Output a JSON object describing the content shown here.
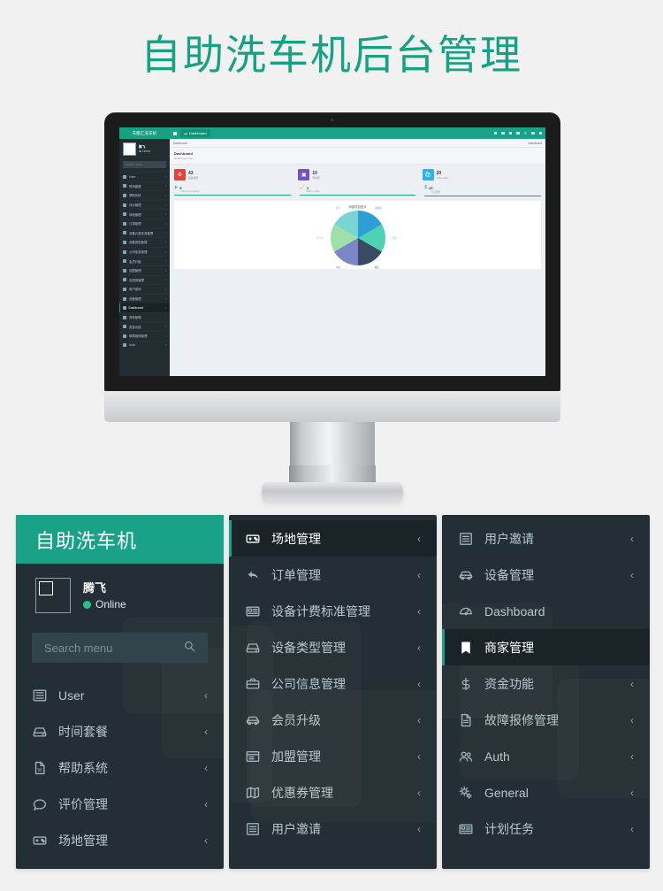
{
  "page": {
    "title": "自助洗车机后台管理",
    "title_color": "#17a184",
    "background": "#f1f1f1"
  },
  "screen": {
    "brand": "车酷汇洗车机",
    "nav_tab": "Dashboard",
    "breadcrumb_left": "Dashboard",
    "breadcrumb_right": "Dashboard",
    "page_header": "Dashboard",
    "page_subtitle": "Dashboard Tips",
    "search_placeholder": "Search menu",
    "user_name": "腾飞",
    "user_status": "Online",
    "stats": [
      {
        "value": "43",
        "label": "设备数量",
        "color": "#e8413d"
      },
      {
        "value": "10",
        "label": "场地数",
        "color": "#6f52c4"
      },
      {
        "value": "20",
        "label": "Total order",
        "color": "#2ab5e6"
      }
    ],
    "mini_stats": [
      {
        "value": "9",
        "label": "Today user signup",
        "color": "#19a287"
      },
      {
        "value": "2",
        "label": "Today's order",
        "color": "#19a287"
      },
      {
        "value": "20",
        "label": "今日营收",
        "color": "#19a287"
      }
    ],
    "chart_title": "消费项目统计",
    "sidebar_items": [
      "User",
      "时间套餐",
      "帮助系统",
      "评价管理",
      "场地管理",
      "订单管理",
      "设备计费标准管理",
      "设备类型管理",
      "公司信息管理",
      "会员升级",
      "加盟管理",
      "优惠券管理",
      "用户邀请",
      "设备管理",
      "Dashboard",
      "商家管理",
      "资金功能",
      "故障报修管理",
      "Auth"
    ],
    "sidebar_active": "Dashboard"
  },
  "chart_data": {
    "type": "pie",
    "title": "消费项目统计",
    "legend_position": "outside-labels",
    "categories": [
      "清洗水",
      "泡沫",
      "吸尘",
      "水蜡",
      "高压水",
      "臭氧"
    ],
    "values": [
      16.7,
      16.7,
      16.7,
      16.7,
      16.7,
      16.7
    ],
    "colors": [
      "#2e9fd4",
      "#4fd1b5",
      "#3b4a63",
      "#7a86c6",
      "#9fe0a8",
      "#79d4d4"
    ]
  },
  "panels": [
    {
      "id": "panel-one",
      "header": "自助洗车机",
      "user_name": "腾飞",
      "user_status": "Online",
      "search_placeholder": "Search menu",
      "items": [
        {
          "label": "User",
          "icon": "list-icon",
          "chevron": "‹",
          "active": false
        },
        {
          "label": "时间套餐",
          "icon": "hard-drive-icon",
          "chevron": "‹",
          "active": false
        },
        {
          "label": "帮助系统",
          "icon": "word-file-icon",
          "chevron": "‹",
          "active": false
        },
        {
          "label": "评价管理",
          "icon": "comment-icon",
          "chevron": "‹",
          "active": false
        },
        {
          "label": "场地管理",
          "icon": "gamepad-icon",
          "chevron": "‹",
          "active": false
        }
      ]
    },
    {
      "id": "panel-two",
      "items": [
        {
          "label": "场地管理",
          "icon": "gamepad-icon",
          "chevron": "‹",
          "active": true
        },
        {
          "label": "订单管理",
          "icon": "reply-all-icon",
          "chevron": "‹",
          "active": false
        },
        {
          "label": "设备计费标准管理",
          "icon": "id-card-icon",
          "chevron": "‹",
          "active": false
        },
        {
          "label": "设备类型管理",
          "icon": "hard-drive-icon",
          "chevron": "‹",
          "active": false
        },
        {
          "label": "公司信息管理",
          "icon": "briefcase-icon",
          "chevron": "‹",
          "active": false
        },
        {
          "label": "会员升级",
          "icon": "car-icon",
          "chevron": "‹",
          "active": false
        },
        {
          "label": "加盟管理",
          "icon": "window-icon",
          "chevron": "‹",
          "active": false
        },
        {
          "label": "优惠券管理",
          "icon": "map-icon",
          "chevron": "‹",
          "active": false
        },
        {
          "label": "用户邀请",
          "icon": "list-alt-icon",
          "chevron": "‹",
          "active": false
        }
      ]
    },
    {
      "id": "panel-three",
      "items": [
        {
          "label": "用户邀请",
          "icon": "list-alt-icon",
          "chevron": "‹",
          "active": false
        },
        {
          "label": "设备管理",
          "icon": "car-icon",
          "chevron": "‹",
          "active": false
        },
        {
          "label": "Dashboard",
          "icon": "dashboard-icon",
          "chevron": "",
          "active": false
        },
        {
          "label": "商家管理",
          "icon": "bookmark-icon",
          "chevron": "",
          "active": true
        },
        {
          "label": "资金功能",
          "icon": "dollar-icon",
          "chevron": "‹",
          "active": false
        },
        {
          "label": "故障报修管理",
          "icon": "file-text-icon",
          "chevron": "‹",
          "active": false
        },
        {
          "label": "Auth",
          "icon": "users-icon",
          "chevron": "‹",
          "active": false
        },
        {
          "label": "General",
          "icon": "cogs-icon",
          "chevron": "‹",
          "active": false
        },
        {
          "label": "计划任务",
          "icon": "id-card-icon",
          "chevron": "‹",
          "active": false
        }
      ]
    }
  ]
}
